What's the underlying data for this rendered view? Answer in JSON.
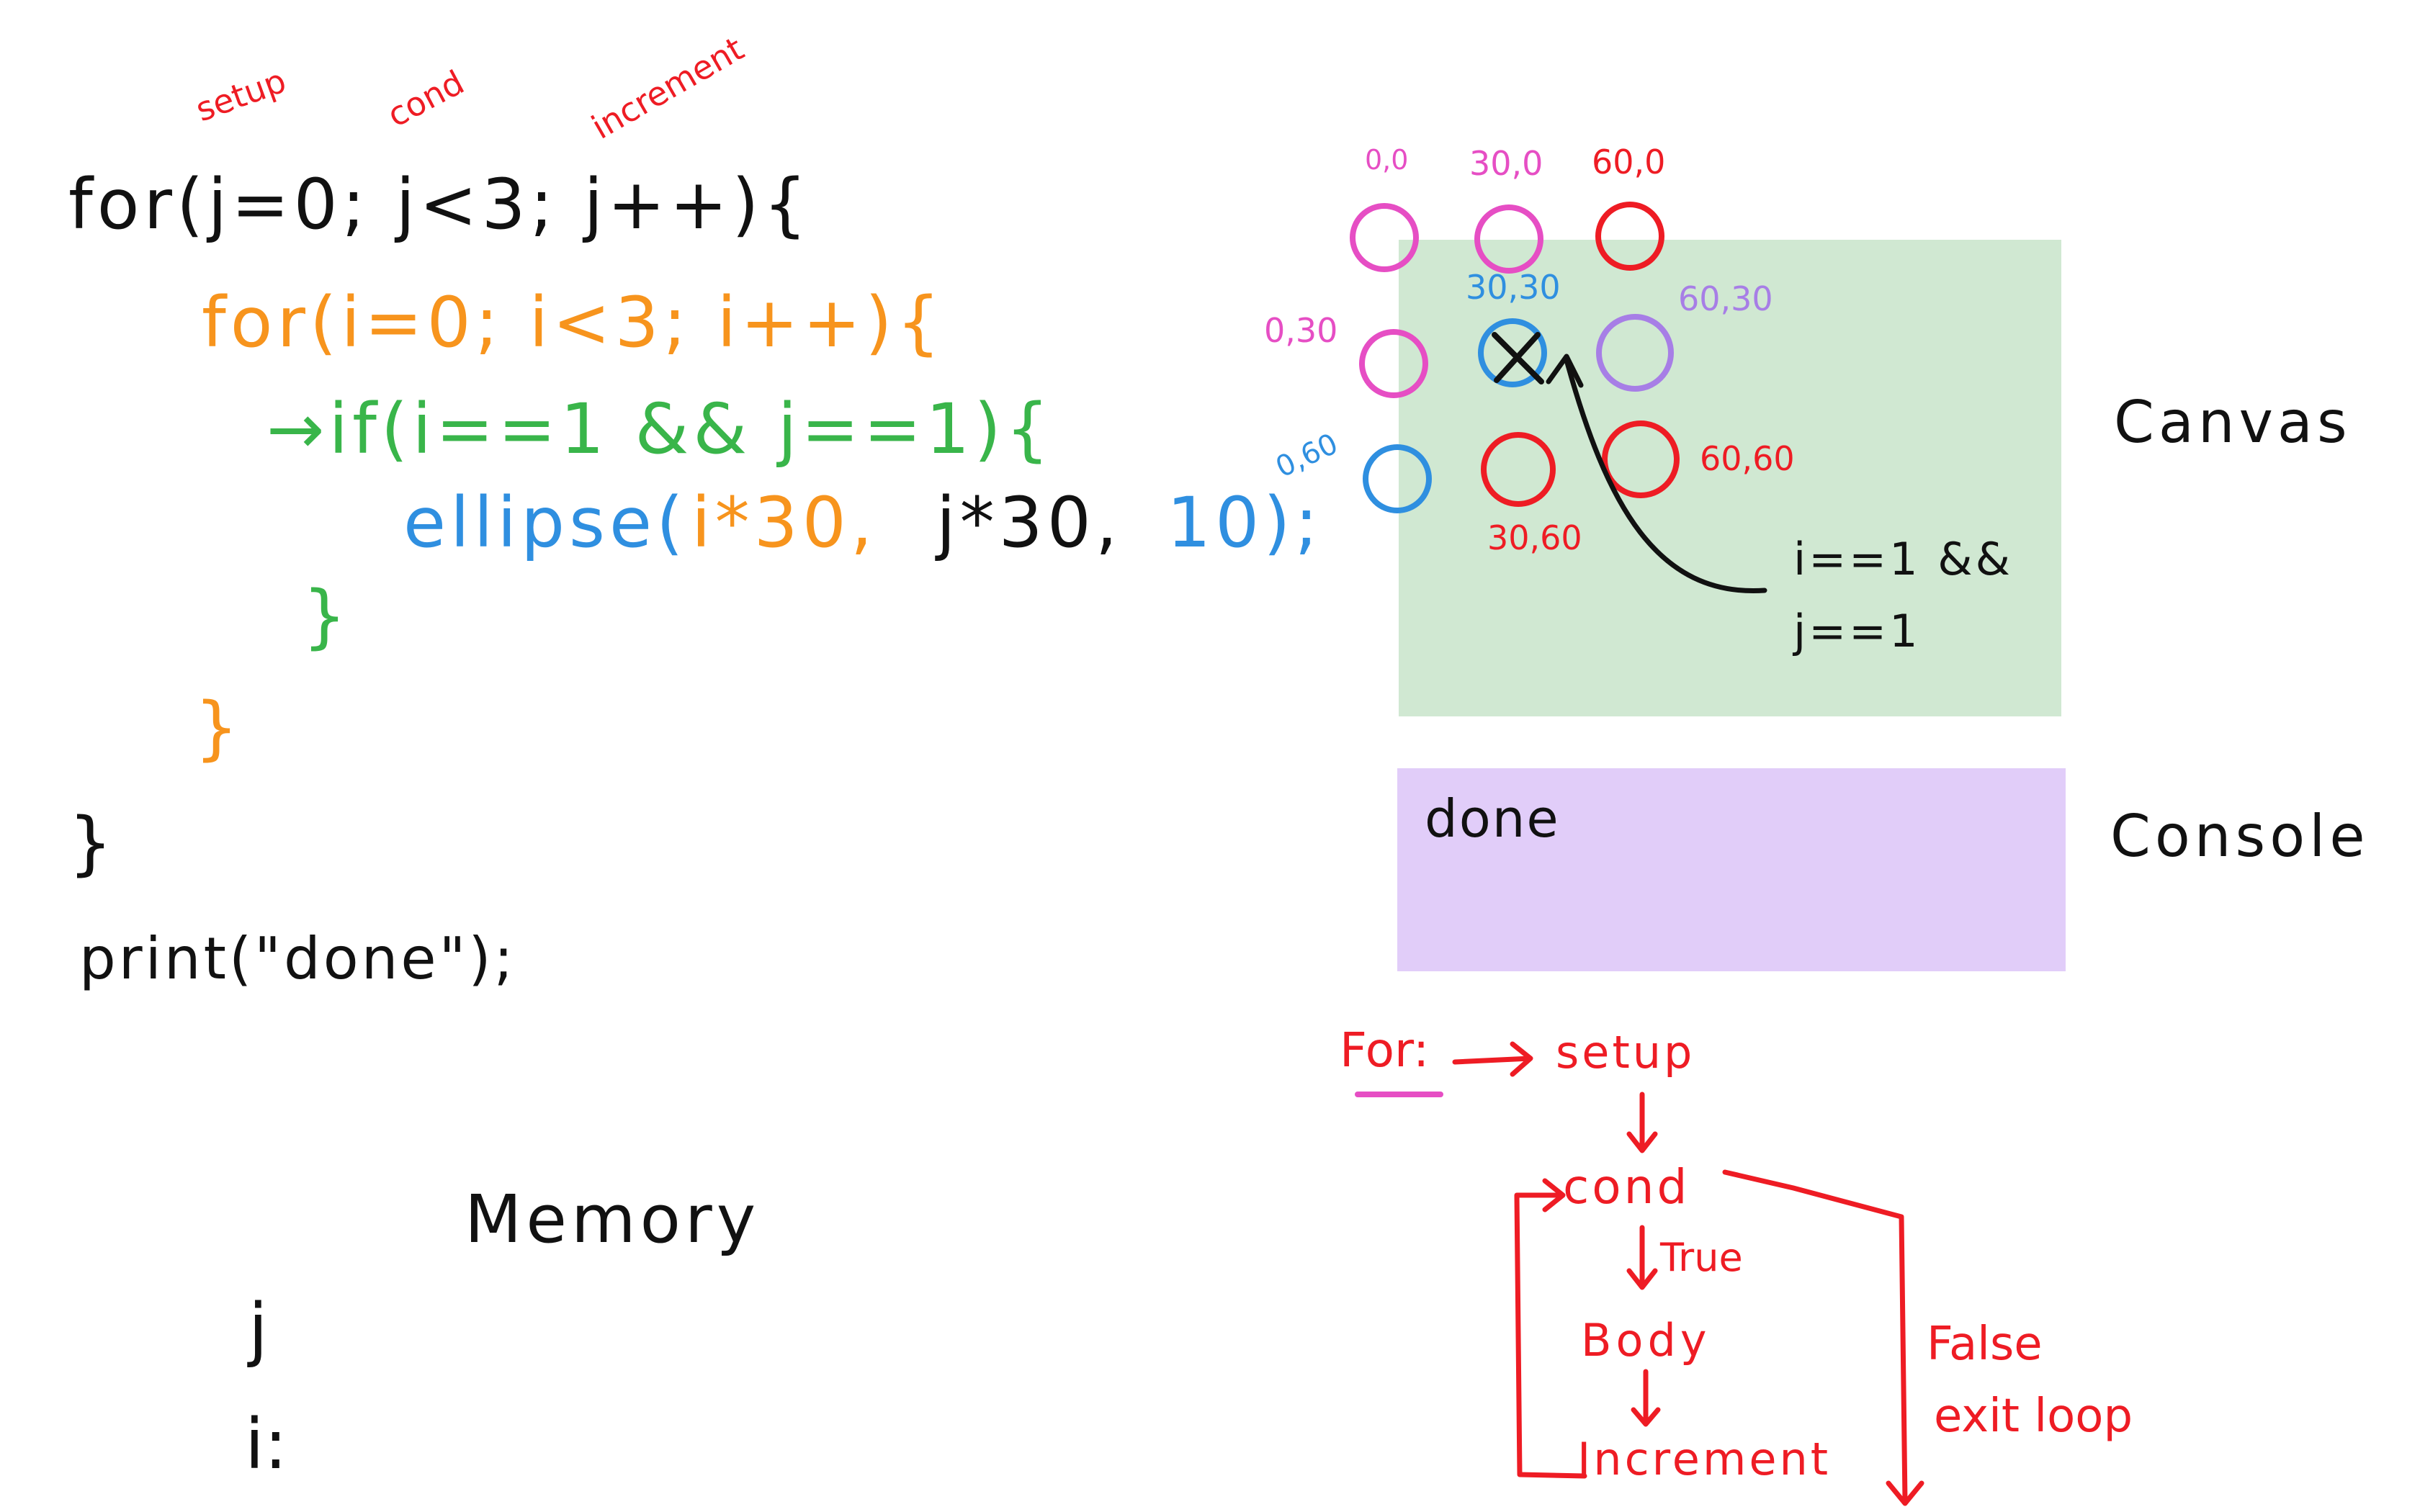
{
  "annotations": {
    "setup": "setup",
    "cond": "cond",
    "increment": "increment"
  },
  "code": {
    "outer_for": "for(j=0; j<3; j++){",
    "inner_for": "for(i=0; i<3; i++){",
    "if_line": "→if(i==1 && j==1){",
    "ellipse_call": "ellipse(",
    "ellipse_x": "i*30,",
    "ellipse_y": "j*30,",
    "ellipse_size": "10);",
    "close_if": "}",
    "close_inner": "}",
    "close_outer": "}",
    "print": "print(\"done\");"
  },
  "memory": {
    "title": "Memory",
    "var_j": "j",
    "var_i": "i:"
  },
  "canvas": {
    "label": "Canvas",
    "fill": "#d0e8d2",
    "points": [
      {
        "label": "0,0",
        "color": "#e64ec4"
      },
      {
        "label": "30,0",
        "color": "#e64ec4"
      },
      {
        "label": "60,0",
        "color": "#ee1c24"
      },
      {
        "label": "0,30",
        "color": "#e64ec4"
      },
      {
        "label": "30,30",
        "color": "#2f8fe0"
      },
      {
        "label": "60,30",
        "color": "#a77ee6"
      },
      {
        "label": "0,60",
        "color": "#2f8fe0"
      },
      {
        "label": "30,60",
        "color": "#ee1c24"
      },
      {
        "label": "60,60",
        "color": "#ee1c24"
      }
    ],
    "condition_line1": "i==1 &&",
    "condition_line2": "j==1"
  },
  "console": {
    "label": "Console",
    "fill": "#e1cdf9",
    "output": "done"
  },
  "flow": {
    "title": "For:",
    "setup": "setup",
    "cond": "cond",
    "true_label": "True",
    "body": "Body",
    "increment": "Increment",
    "false_line1": "False",
    "false_line2": "exit loop"
  },
  "colors": {
    "red": "#ee1c24",
    "black": "#111111",
    "orange": "#f7941d",
    "green": "#39b54a",
    "blue": "#2f8fe0",
    "magenta": "#e64ec4",
    "purple": "#a77ee6"
  }
}
